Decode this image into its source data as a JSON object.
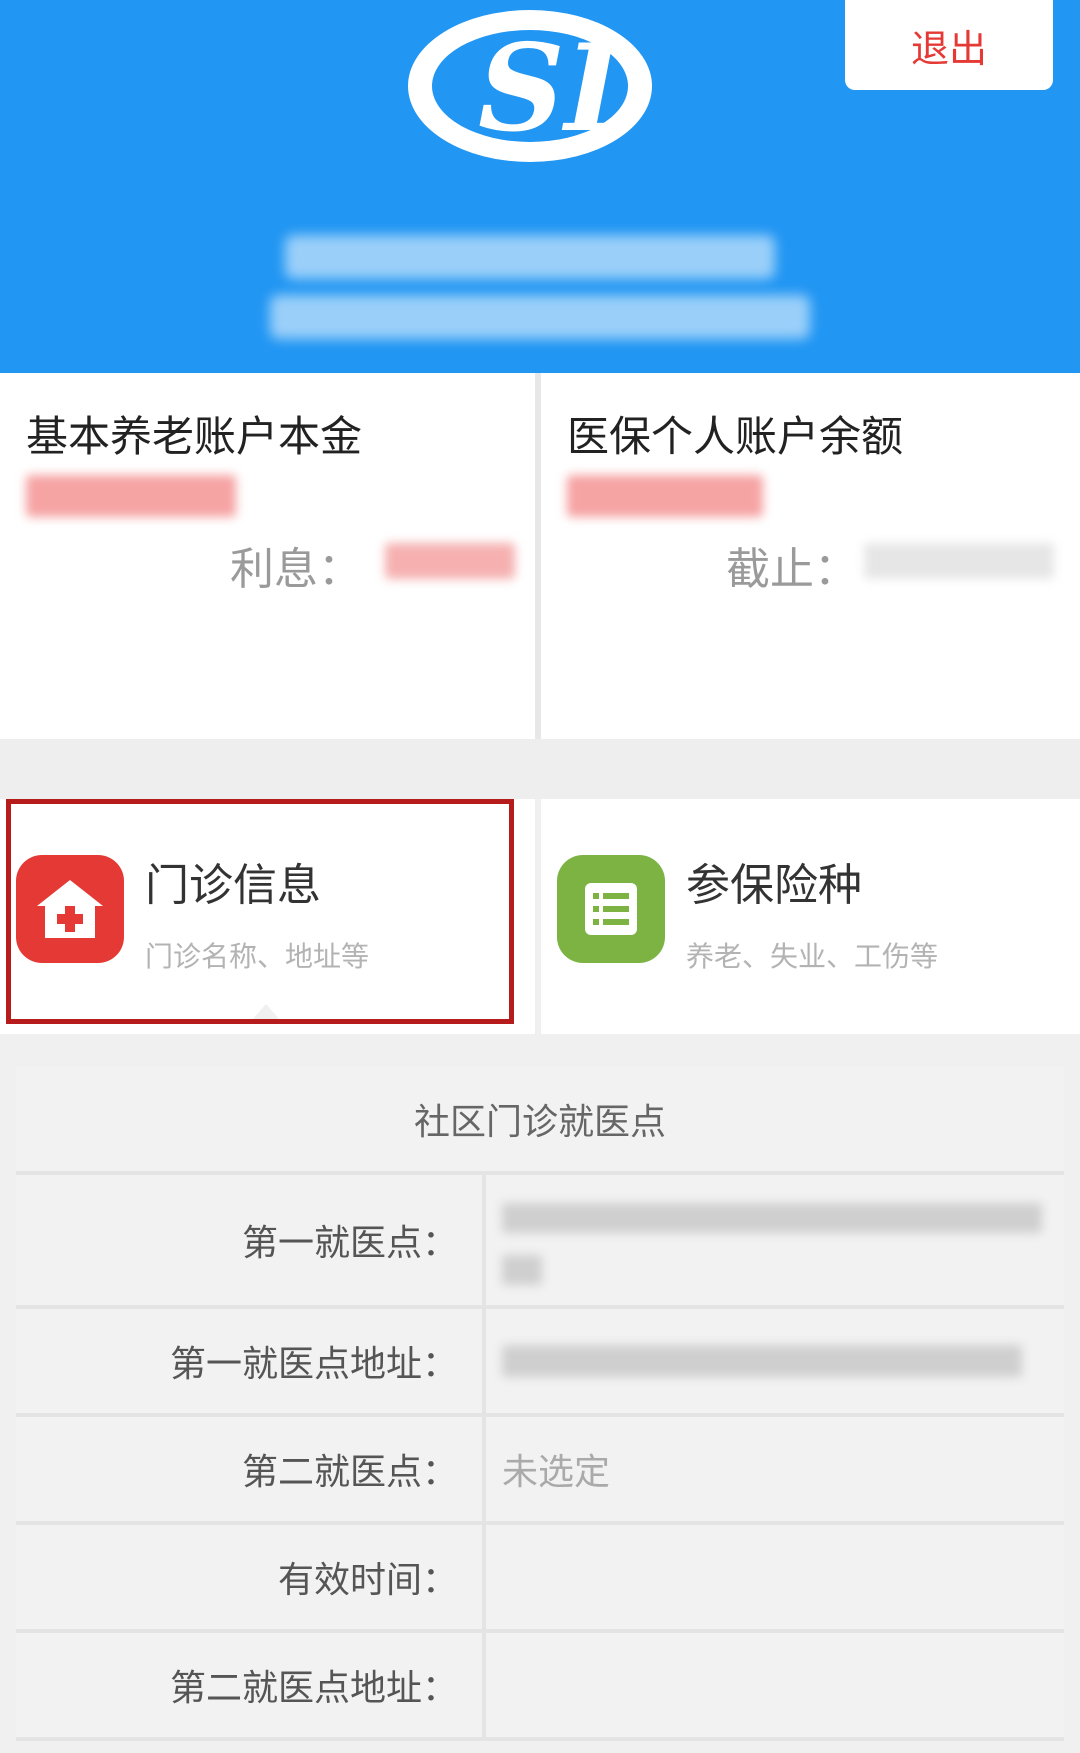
{
  "header": {
    "logo_text": "SI",
    "logout_label": "退出"
  },
  "accounts": {
    "pension": {
      "title": "基本养老账户本金",
      "interest_label": "利息："
    },
    "medical": {
      "title": "医保个人账户余额",
      "as_of_label": "截止："
    }
  },
  "menu": [
    {
      "title": "门诊信息",
      "subtitle": "门诊名称、地址等",
      "icon": "hospital-icon",
      "color": "#e53935"
    },
    {
      "title": "参保险种",
      "subtitle": "养老、失业、工伤等",
      "icon": "list-icon",
      "color": "#7cb342"
    }
  ],
  "table": {
    "heading": "社区门诊就医点",
    "rows": [
      {
        "label": "第一就医点：",
        "value": ""
      },
      {
        "label": "第一就医点地址：",
        "value": ""
      },
      {
        "label": "第二就医点：",
        "value": "未选定"
      },
      {
        "label": "有效时间：",
        "value": ""
      },
      {
        "label": "第二就医点地址：",
        "value": ""
      }
    ]
  }
}
